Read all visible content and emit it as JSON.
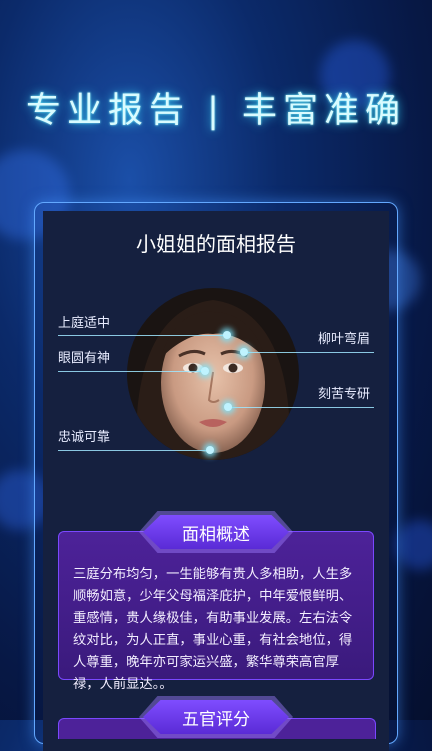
{
  "headline": "专业报告 | 丰富准确",
  "report": {
    "title": "小姐姐的面相报告",
    "features": {
      "upper_court": "上庭适中",
      "eyes": "眼圆有神",
      "brows": "柳叶弯眉",
      "nose": "刻苦专研",
      "mouth": "忠诚可靠"
    }
  },
  "overview": {
    "title": "面相概述",
    "text": "三庭分布均匀，一生能够有贵人多相助，人生多顺畅如意，少年父母福泽庇护，中年爱恨鲜明、重感情，贵人缘极佳，有助事业发展。左右法令纹对比，为人正直，事业心重，有社会地位，得人尊重，晚年亦可家运兴盛，繁华尊荣高官厚禄，人前显达。。"
  },
  "five_features": {
    "title": "五官评分"
  },
  "colors": {
    "accent": "#7a48ff",
    "glow": "#37d9ff",
    "card": "#15203f"
  }
}
